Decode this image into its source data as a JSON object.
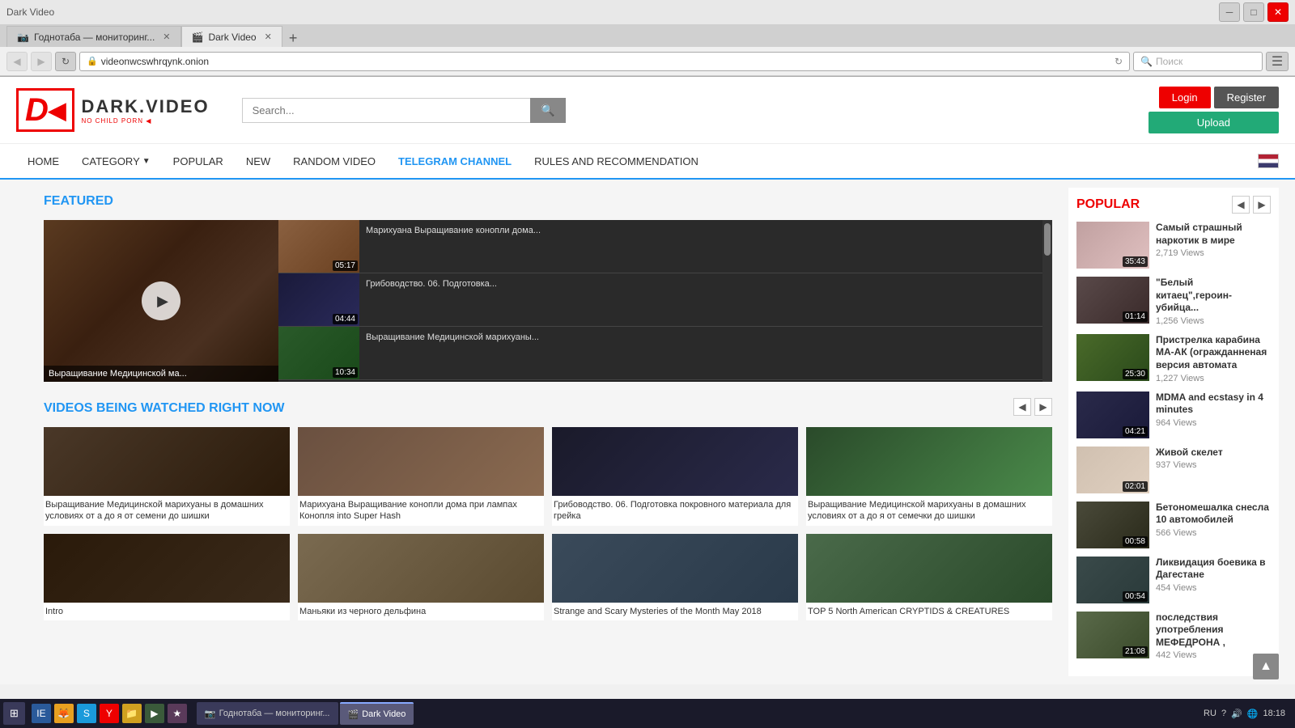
{
  "browser": {
    "tabs": [
      {
        "id": "tab1",
        "icon": "📷",
        "title": "Годнотаба — мониторинг...",
        "active": false
      },
      {
        "id": "tab2",
        "icon": "🎬",
        "title": "Dark Video",
        "active": true
      }
    ],
    "new_tab_label": "+",
    "address": "videonwcswhrqynk.onion",
    "search_placeholder": "Поиск",
    "close_label": "✕",
    "min_label": "─",
    "max_label": "□",
    "win_close": "✕"
  },
  "logo": {
    "d": "D",
    "arrow": "◀",
    "dark": "DARK.",
    "video": "VIDEO",
    "subtitle": "NO CHILD PORN ◀"
  },
  "search": {
    "placeholder": "Search...",
    "btn_icon": "🔍"
  },
  "header_buttons": {
    "login": "Login",
    "register": "Register",
    "upload": "Upload"
  },
  "nav": {
    "items": [
      {
        "id": "home",
        "label": "HOME",
        "active": false
      },
      {
        "id": "category",
        "label": "CATEGORY",
        "active": false,
        "has_arrow": true
      },
      {
        "id": "popular",
        "label": "POPULAR",
        "active": false
      },
      {
        "id": "new",
        "label": "NEW",
        "active": false
      },
      {
        "id": "random",
        "label": "RANDOM VIDEO",
        "active": false
      },
      {
        "id": "telegram",
        "label": "TELEGRAM CHANNEL",
        "active": true
      },
      {
        "id": "rules",
        "label": "RULES AND RECOMMENDATION",
        "active": false
      }
    ]
  },
  "featured": {
    "title": "FEATURED",
    "main_title": "Выращивание Медицинской ма...",
    "items": [
      {
        "title": "Марихуана Выращивание конопли дома...",
        "duration": "05:17",
        "thumb_class": "thumb-1"
      },
      {
        "title": "Грибоводство. 06. Подготовка...",
        "duration": "04:44",
        "thumb_class": "thumb-2"
      },
      {
        "title": "Выращивание Медицинской марихуаны...",
        "duration": "10:34",
        "thumb_class": "thumb-3"
      }
    ]
  },
  "watched": {
    "title": "VIDEOS BEING WATCHED RIGHT NOW",
    "videos": [
      {
        "title": "Выращивание Медицинской марихуаны в домашних условиях от а до я от семени до шишки",
        "thumb_class": "vt-1"
      },
      {
        "title": "Марихуана Выращивание конопли дома при лампах Конопля into Super Hash",
        "thumb_class": "vt-2"
      },
      {
        "title": "Грибоводство. 06. Подготовка покровного материала для грейка",
        "thumb_class": "vt-3"
      },
      {
        "title": "Выращивание Медицинской марихуаны в домашних условиях от а до я от семечки до шишки",
        "thumb_class": "vt-4"
      },
      {
        "title": "Intro",
        "thumb_class": "vt-5"
      },
      {
        "title": "Маньяки из черного дельфина",
        "thumb_class": "vt-6"
      },
      {
        "title": "Strange and Scary Mysteries of the Month May 2018",
        "thumb_class": "vt-7"
      },
      {
        "title": "TOP 5 North American CRYPTIDS & CREATURES",
        "thumb_class": "vt-8"
      }
    ]
  },
  "popular": {
    "title": "POPULAR",
    "items": [
      {
        "title": "Самый страшный наркотик в мире",
        "views": "2,719 Views",
        "duration": "35:43",
        "thumb_class": "pt-1"
      },
      {
        "title": "\"Белый китаец\",героин-убийца...",
        "views": "1,256 Views",
        "duration": "01:14",
        "thumb_class": "pt-2"
      },
      {
        "title": "Пристрелка карабина МА-АК (огражданненая версия автомата",
        "views": "1,227 Views",
        "duration": "25:30",
        "thumb_class": "pt-3"
      },
      {
        "title": "MDMA and ecstasy in 4 minutes",
        "views": "964 Views",
        "duration": "04:21",
        "thumb_class": "pt-4"
      },
      {
        "title": "Живой скелет",
        "views": "937 Views",
        "duration": "02:01",
        "thumb_class": "pt-5"
      },
      {
        "title": "Бетономешалка снесла 10 автомобилей",
        "views": "566 Views",
        "duration": "00:58",
        "thumb_class": "pt-6"
      },
      {
        "title": "Ликвидация боевика в Дагестане",
        "views": "454 Views",
        "duration": "00:54",
        "thumb_class": "pt-7"
      },
      {
        "title": "последствия употребления МЕФЕДРОНА ,",
        "views": "442 Views",
        "duration": "21:08",
        "thumb_class": "pt-8"
      }
    ]
  },
  "taskbar": {
    "time": "18:18",
    "lang": "RU",
    "apps": [
      {
        "label": "Годнотаба — мониторинг...",
        "active": false
      },
      {
        "label": "Dark Video",
        "active": true
      }
    ]
  }
}
